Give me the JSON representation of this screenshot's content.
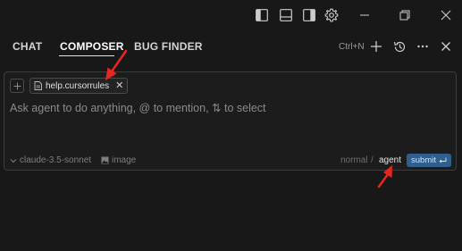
{
  "titlebar": {
    "icons": [
      "toggle-primary-sidebar-icon",
      "toggle-panel-icon",
      "toggle-secondary-sidebar-icon",
      "gear-icon",
      "minimize-icon",
      "restore-icon",
      "close-icon"
    ]
  },
  "tabs": [
    {
      "label": "CHAT",
      "active": false
    },
    {
      "label": "COMPOSER",
      "active": true
    },
    {
      "label": "BUG FINDER",
      "active": false
    }
  ],
  "actions": {
    "shortcut": "Ctrl+N",
    "icons": [
      "plus-icon",
      "history-icon",
      "more-icon",
      "close-icon"
    ]
  },
  "composer": {
    "context_chip": "help.cursorrules",
    "placeholder": "Ask agent to do anything, @ to mention, ⇅ to select",
    "model": "claude-3.5-sonnet",
    "image_label": "image",
    "mode_normal": "normal",
    "mode_separator": "/",
    "mode_agent": "agent",
    "submit_label": "submit"
  },
  "colors": {
    "background": "#181818",
    "submit": "#2f5f8f",
    "annotation_arrow": "#e8261f"
  }
}
